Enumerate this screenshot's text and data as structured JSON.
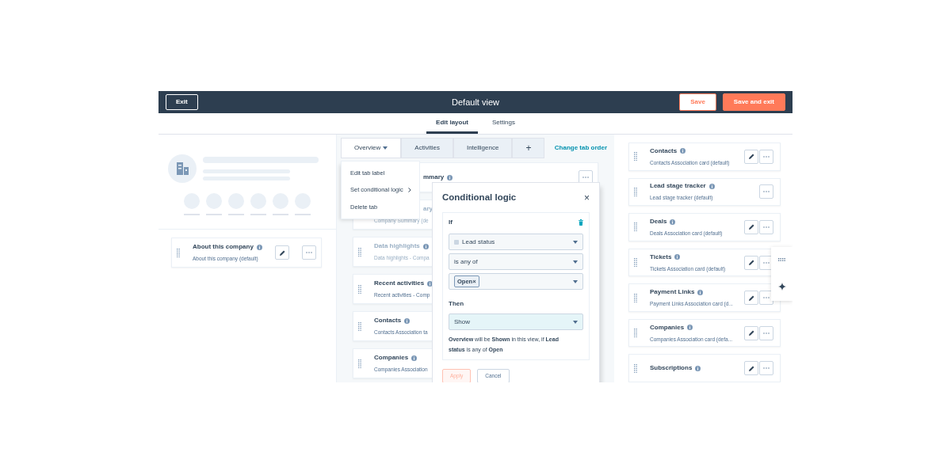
{
  "header": {
    "exit": "Exit",
    "title": "Default view",
    "buttons": [
      {
        "label": "Save",
        "kind": "secondary"
      },
      {
        "label": "Save and exit",
        "kind": "primary"
      }
    ]
  },
  "subtabs": [
    {
      "label": "Edit layout",
      "selected": true
    },
    {
      "label": "Settings",
      "selected": false
    }
  ],
  "left": {
    "cards": [
      {
        "title": "About this company",
        "subtitle": "About this company (default)",
        "editable": true
      }
    ]
  },
  "middle": {
    "tabs": [
      {
        "label": "Overview",
        "selected": true,
        "dropdown": true
      },
      {
        "label": "Activities",
        "selected": false,
        "dropdown": false
      },
      {
        "label": "Intelligence",
        "selected": false,
        "dropdown": false
      },
      {
        "label": "+",
        "selected": false,
        "dropdown": false
      }
    ],
    "change_link": "Change tab order",
    "cards": [
      {
        "kind": "covered",
        "title": "mmary",
        "dimmed": false,
        "actions": true
      },
      {
        "kind": "covered-both",
        "title": "ary",
        "subtitle": "Company Summary (de",
        "dimmed": true
      },
      {
        "kind": "normal",
        "title": "Data highlights",
        "subtitle": "Data highlights - Compa",
        "dimmed": true
      },
      {
        "kind": "normal",
        "title": "Recent activities",
        "subtitle": "Recent activities - Comp",
        "dimmed": false
      },
      {
        "kind": "normal",
        "title": "Contacts",
        "subtitle": "Contacts Association ta",
        "dimmed": false
      },
      {
        "kind": "normal",
        "title": "Companies",
        "subtitle": "Companies Association",
        "dimmed": false
      }
    ],
    "menu": {
      "items": [
        {
          "label": "Edit tab label",
          "submenu": false
        },
        {
          "label": "Set conditional logic",
          "submenu": true
        },
        {
          "label": "Delete tab",
          "submenu": false
        }
      ]
    },
    "popover": {
      "title": "Conditional logic",
      "close": "×",
      "if_label": "If",
      "field": "Lead status",
      "operator": "is any of",
      "values": [
        {
          "label": "Open",
          "remove": "×"
        }
      ],
      "then_label": "Then",
      "action": "Show",
      "summary": "**Overview** will be **Shown** in this view, if **Lead status** is any of **Open**",
      "buttons": [
        {
          "label": "Apply",
          "kind": "primary",
          "disabled": true
        },
        {
          "label": "Cancel",
          "kind": "secondary",
          "disabled": false
        }
      ]
    }
  },
  "right": {
    "cards": [
      {
        "title": "Contacts",
        "subtitle": "Contacts Association card (default)",
        "editable": true
      },
      {
        "title": "Lead stage tracker",
        "subtitle": "Lead stage tracker (default)",
        "editable": false
      },
      {
        "title": "Deals",
        "subtitle": "Deals Association card (default)",
        "editable": true
      },
      {
        "title": "Tickets",
        "subtitle": "Tickets Association card (default)",
        "editable": true
      },
      {
        "title": "Payment Links",
        "subtitle": "Payment Links Association card (d...",
        "editable": true
      },
      {
        "title": "Companies",
        "subtitle": "Companies Association card (defa...",
        "editable": true
      },
      {
        "title": "Subscriptions",
        "editable": true
      }
    ]
  }
}
